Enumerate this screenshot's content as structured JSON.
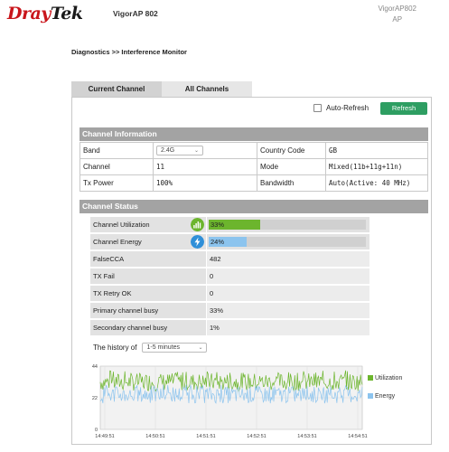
{
  "header": {
    "logo_part1": "Dray",
    "logo_part2": "Tek",
    "model": "VigorAP 802",
    "device_name_line1": "VigorAP802",
    "device_name_line2": "AP"
  },
  "breadcrumb": "Diagnostics >> Interference Monitor",
  "tabs": [
    {
      "label": "Current Channel",
      "active": true
    },
    {
      "label": "All Channels",
      "active": false
    }
  ],
  "auto_refresh": {
    "label": "Auto-Refresh",
    "checked": false
  },
  "refresh_button": "Refresh",
  "channel_information": {
    "title": "Channel Information",
    "band_label": "Band",
    "band_value": "2.4G",
    "country_label": "Country Code",
    "country_value": "GB",
    "channel_label": "Channel",
    "channel_value": "11",
    "mode_label": "Mode",
    "mode_value": "Mixed(11b+11g+11n)",
    "txpower_label": "Tx Power",
    "txpower_value": "100%",
    "bandwidth_label": "Bandwidth",
    "bandwidth_value": "Auto(Active: 40 MHz)"
  },
  "channel_status": {
    "title": "Channel Status",
    "rows": [
      {
        "label": "Channel Utilization",
        "value": "33%",
        "percent": 33,
        "color": "#6cb52d",
        "icon": "signal-bars-icon"
      },
      {
        "label": "Channel Energy",
        "value": "24%",
        "percent": 24,
        "color": "#8cc4ee",
        "icon": "lightning-icon"
      },
      {
        "label": "FalseCCA",
        "value": "482"
      },
      {
        "label": "TX Fail",
        "value": "0"
      },
      {
        "label": "TX Retry OK",
        "value": "0"
      },
      {
        "label": "Primary channel busy",
        "value": "33%"
      },
      {
        "label": "Secondary channel busy",
        "value": "1%"
      }
    ]
  },
  "history": {
    "label": "The history of",
    "selected": "1-5 minutes"
  },
  "chart_data": {
    "type": "line",
    "y_ticks": [
      "44",
      "22",
      "0"
    ],
    "ylim": [
      0,
      44
    ],
    "x_ticks": [
      "14:49:51",
      "14:50:51",
      "14:51:51",
      "14:52:51",
      "14:53:51",
      "14:54:51"
    ],
    "series": [
      {
        "name": "Utilization",
        "color": "#6cb52d",
        "approx_mean": 33,
        "approx_min": 27,
        "approx_max": 41
      },
      {
        "name": "Energy",
        "color": "#8cc4ee",
        "approx_mean": 24,
        "approx_min": 18,
        "approx_max": 31
      }
    ]
  }
}
